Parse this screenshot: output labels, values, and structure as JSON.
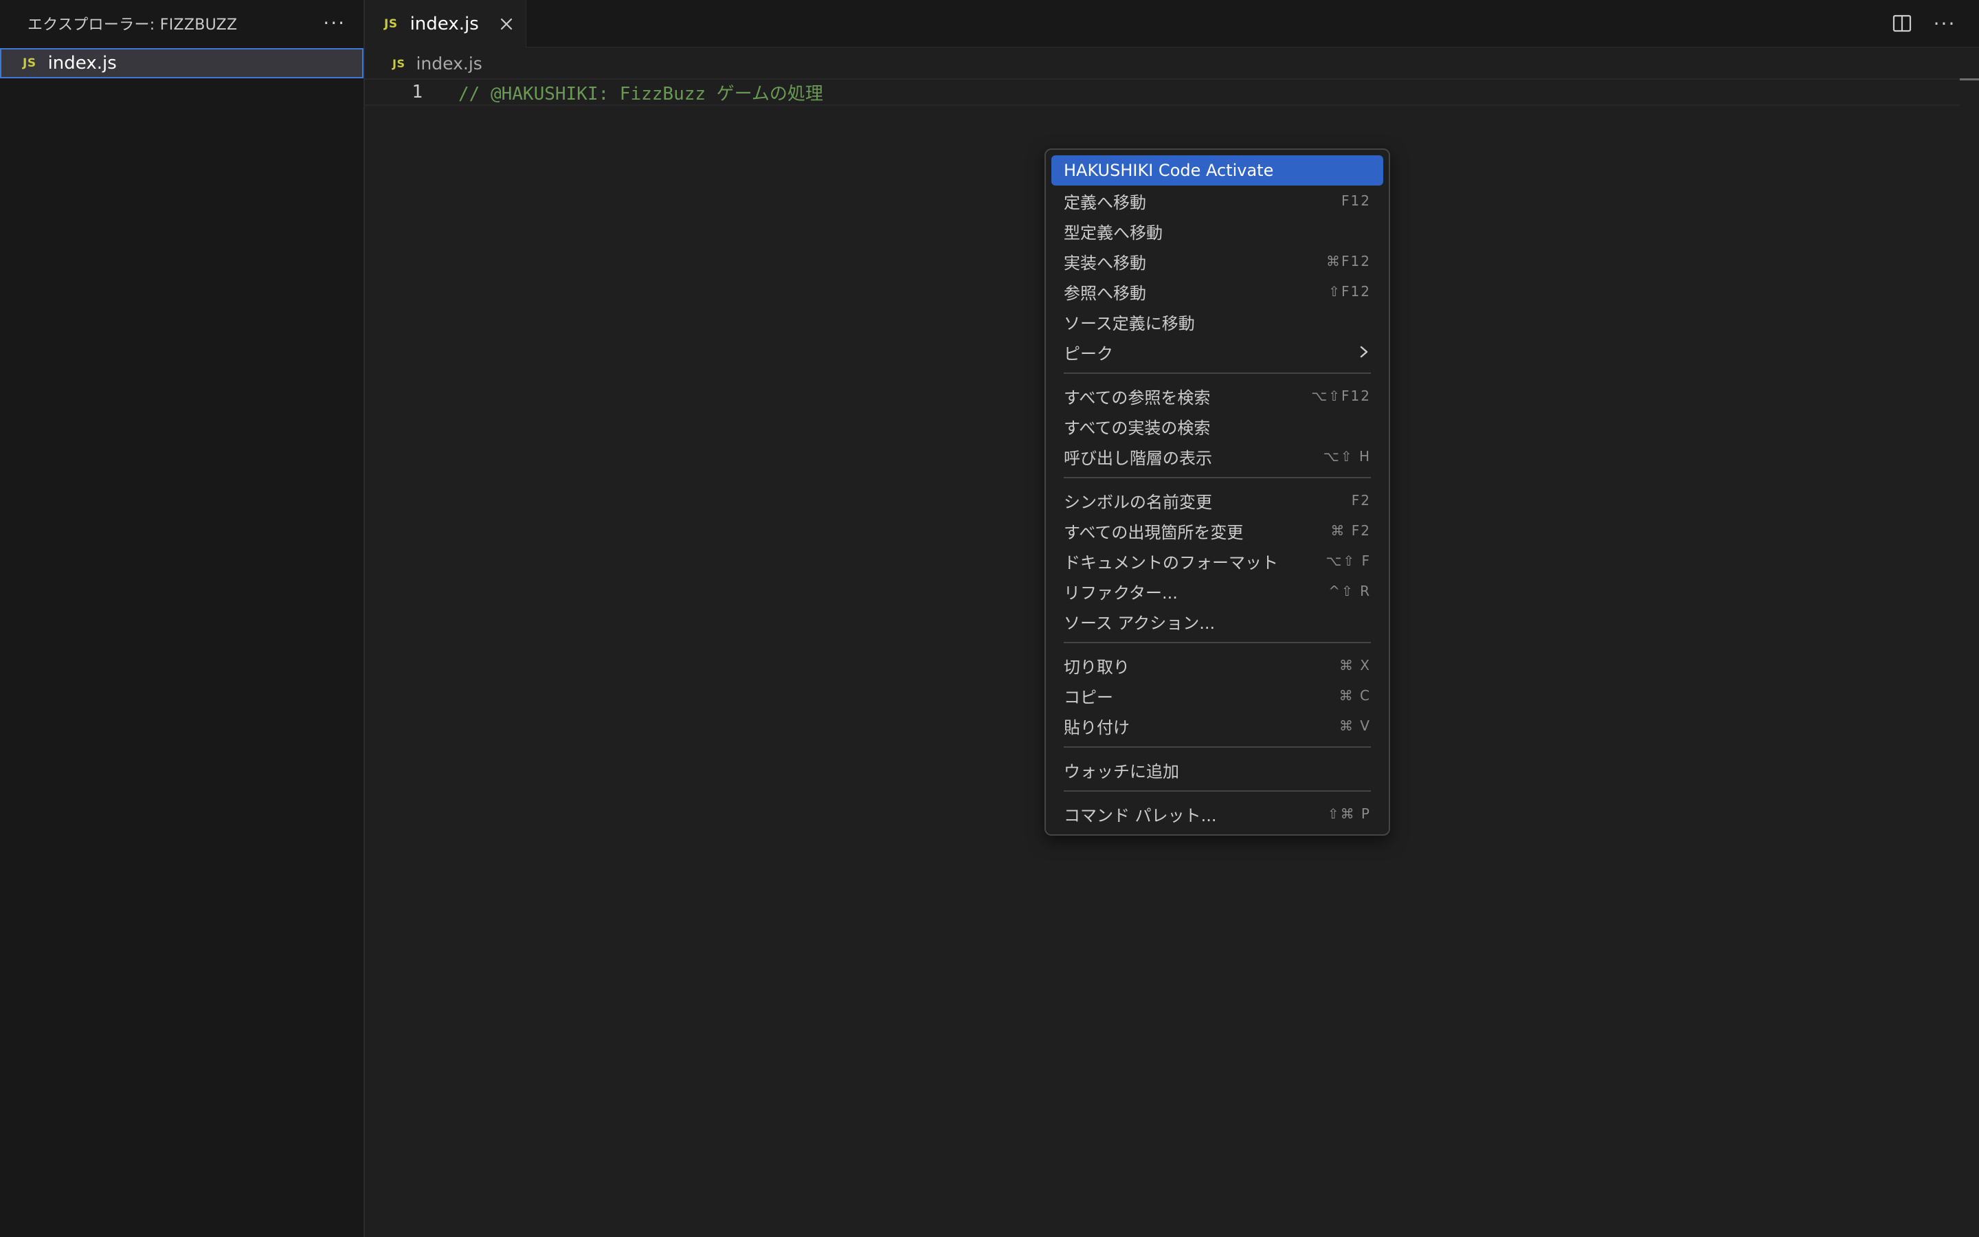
{
  "sidebar": {
    "title": "エクスプローラー: FIZZBUZZ",
    "more_icon": "more-actions-icon",
    "files": [
      {
        "icon_label": "JS",
        "name": "index.js",
        "selected": true
      }
    ]
  },
  "tabs": [
    {
      "icon_label": "JS",
      "label": "index.js",
      "active": true
    }
  ],
  "tab_actions": {
    "split_icon": "split-editor-icon",
    "more_icon": "more-actions-icon"
  },
  "breadcrumb": {
    "icon_label": "JS",
    "file": "index.js"
  },
  "editor": {
    "lines": [
      {
        "number": "1",
        "code": "// @HAKUSHIKI: FizzBuzz ゲームの処理"
      }
    ]
  },
  "context_menu": {
    "groups": [
      [
        {
          "label": "HAKUSHIKI Code Activate",
          "shortcut": "",
          "active": true
        },
        {
          "label": "定義へ移動",
          "shortcut": "F12"
        },
        {
          "label": "型定義へ移動",
          "shortcut": ""
        },
        {
          "label": "実装へ移動",
          "shortcut": "⌘F12"
        },
        {
          "label": "参照へ移動",
          "shortcut": "⇧F12"
        },
        {
          "label": "ソース定義に移動",
          "shortcut": ""
        },
        {
          "label": "ピーク",
          "shortcut": "",
          "submenu": true
        }
      ],
      [
        {
          "label": "すべての参照を検索",
          "shortcut": "⌥⇧F12"
        },
        {
          "label": "すべての実装の検索",
          "shortcut": ""
        },
        {
          "label": "呼び出し階層の表示",
          "shortcut": "⌥⇧ H"
        }
      ],
      [
        {
          "label": "シンボルの名前変更",
          "shortcut": "F2"
        },
        {
          "label": "すべての出現箇所を変更",
          "shortcut": "⌘ F2"
        },
        {
          "label": "ドキュメントのフォーマット",
          "shortcut": "⌥⇧ F"
        },
        {
          "label": "リファクター...",
          "shortcut": "^⇧ R"
        },
        {
          "label": "ソース アクション...",
          "shortcut": ""
        }
      ],
      [
        {
          "label": "切り取り",
          "shortcut": "⌘ X"
        },
        {
          "label": "コピー",
          "shortcut": "⌘ C"
        },
        {
          "label": "貼り付け",
          "shortcut": "⌘ V"
        }
      ],
      [
        {
          "label": "ウォッチに追加",
          "shortcut": ""
        }
      ],
      [
        {
          "label": "コマンド パレット...",
          "shortcut": "⇧⌘ P"
        }
      ]
    ]
  },
  "colors": {
    "accent": "#2f64c6",
    "selection_border": "#3f78d6",
    "comment": "#6a9955",
    "js_icon": "#cbcb41"
  }
}
